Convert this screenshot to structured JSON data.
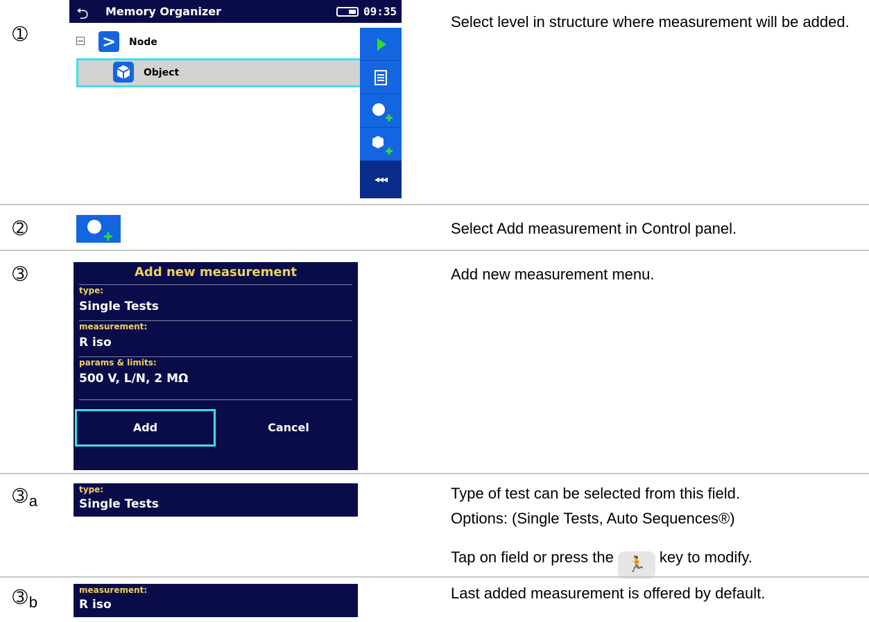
{
  "steps": {
    "s1": "➀",
    "s2": "➁",
    "s3": "➂",
    "s3a": "➂",
    "s3a_sub": "a",
    "s3b": "➂",
    "s3b_sub": "b"
  },
  "screen1": {
    "title": "Memory Organizer",
    "time": "09:35",
    "node_label": "Node",
    "object_label": "Object",
    "control_panel": [
      "play-icon",
      "list-icon",
      "add-measurement-icon",
      "add-object-icon",
      "more-icon"
    ],
    "more_glyph": "◂◂◂"
  },
  "dialog": {
    "title": "Add new measurement",
    "type_label": "type:",
    "type_value": "Single Tests",
    "measurement_label": "measurement:",
    "measurement_value": "R iso",
    "params_label": "params & limits:",
    "params_value": "500 V, L/N, 2 MΩ",
    "add": "Add",
    "cancel": "Cancel"
  },
  "field_type": {
    "label": "type:",
    "value": "Single Tests"
  },
  "field_measurement": {
    "label": "measurement:",
    "value": "R iso"
  },
  "descriptions": {
    "d1": "Select level in structure where measurement will be added.",
    "d2": "Select Add measurement in Control panel.",
    "d3": "Add new measurement menu.",
    "d3a_1": "Type of test can be selected from this field.",
    "d3a_2": "Options: (Single Tests, Auto Sequences®)",
    "d3a_3_pre": "Tap on field or press the",
    "d3a_3_post": "key to modify.",
    "d3b": "Last added measurement is offered by default."
  },
  "colors": {
    "screen_bg": "#0a0c4a",
    "accent_blue": "#1466e0",
    "selection_cyan": "#3ee0ec",
    "label_yellow": "#f0d060",
    "play_green": "#2fe02f"
  }
}
